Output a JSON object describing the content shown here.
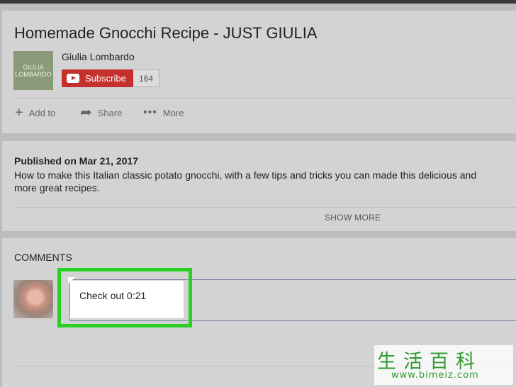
{
  "video": {
    "title": "Homemade Gnocchi Recipe - JUST GIULIA",
    "channel_name": "Giulia Lombardo",
    "channel_logo_text": "GIULIA LOMBARDO",
    "subscribe_label": "Subscribe",
    "subscriber_count": "164",
    "actions": {
      "add_to": "Add to",
      "share": "Share",
      "more": "More"
    }
  },
  "description": {
    "published": "Published on Mar 21, 2017",
    "line1": "How to make this Italian classic potato gnocchi, with a few tips and tricks you can made this delicious and",
    "line2": "more great recipes.",
    "show_more": "SHOW MORE"
  },
  "comments": {
    "heading": "COMMENTS",
    "input_value": "Check out 0:21"
  },
  "watermark": {
    "chinese": "生活百科",
    "url": "www.bimeiz.com"
  },
  "colors": {
    "subscribe": "#c4302b",
    "highlight": "#27d021",
    "watermark": "#2f9a2f"
  }
}
